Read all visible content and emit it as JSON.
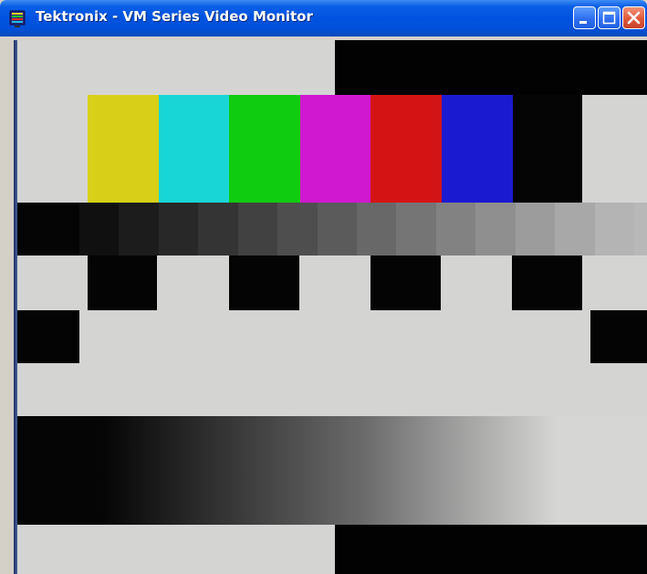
{
  "window": {
    "title": "Tektronix - VM Series Video Monitor"
  },
  "titlebar": {
    "app_icon": "monitor-icon",
    "buttons": [
      {
        "name": "minimize",
        "icon": "minimize-icon"
      },
      {
        "name": "maximize",
        "icon": "maximize-icon"
      },
      {
        "name": "close",
        "icon": "close-icon"
      }
    ]
  },
  "test_pattern": {
    "color_bars": [
      "#d8d018",
      "#19d6d6",
      "#10cc10",
      "#d018d0",
      "#d41414",
      "#1a1ad0"
    ],
    "background_light": "#d4d5d3",
    "background_dark": "#020202",
    "grayscale_steps": [
      "#101010",
      "#1c1c1c",
      "#282828",
      "#343434",
      "#414141",
      "#4e4e4e",
      "#5b5b5b",
      "#686868",
      "#757575",
      "#828282",
      "#8f8f8f",
      "#9c9c9c",
      "#a8a8a8",
      "#b4b4b4"
    ],
    "ramp_start": "#050505",
    "ramp_end": "#d6d7d5"
  }
}
